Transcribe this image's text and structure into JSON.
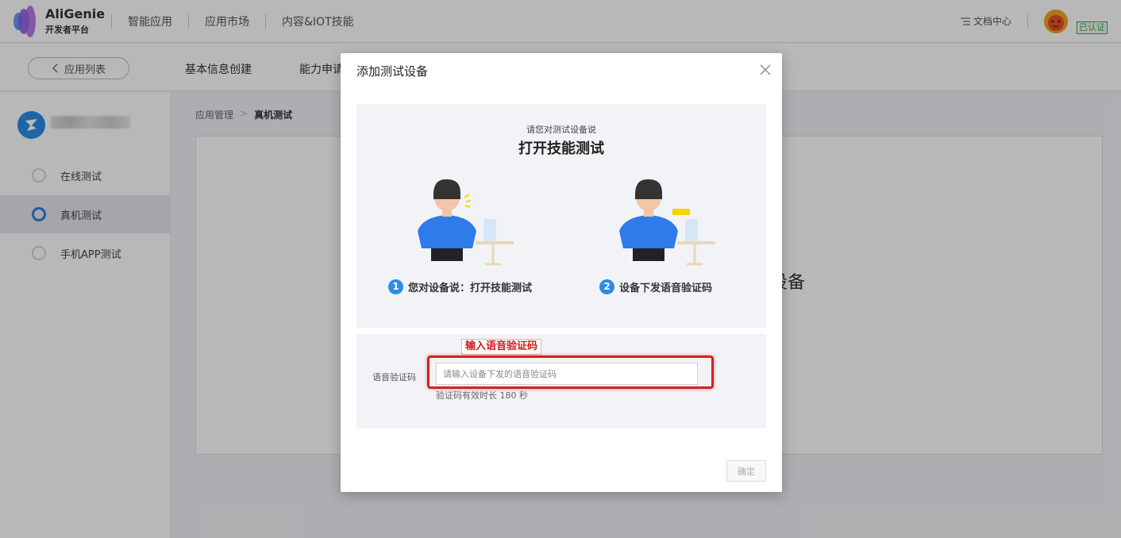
{
  "header": {
    "brand_name": "AliGenie",
    "brand_sub": "开发者平台",
    "nav": [
      "智能应用",
      "应用市场",
      "内容&IOT技能"
    ],
    "doc_link": "文档中心",
    "user_name": "",
    "verified_badge": "已认证"
  },
  "subnav": {
    "back_label": "应用列表",
    "items": [
      "基本信息创建",
      "能力申请"
    ]
  },
  "sidebar": {
    "app_name": "",
    "items": [
      {
        "label": "在线测试",
        "active": false
      },
      {
        "label": "真机测试",
        "active": true
      },
      {
        "label": "手机APP测试",
        "active": false
      }
    ]
  },
  "breadcrumb": {
    "parent": "应用管理",
    "separator": ">",
    "current": "真机测试"
  },
  "panel": {
    "partial_text": "设备"
  },
  "modal": {
    "title": "添加测试设备",
    "instruction_sub": "请您对测试设备说",
    "instruction_main": "打开技能测试",
    "steps": [
      {
        "num": "1",
        "label": "您对设备说：打开技能测试"
      },
      {
        "num": "2",
        "label": "设备下发语音验证码"
      }
    ],
    "annotation": "输入语音验证码",
    "field_label": "语音验证码",
    "input_value": "",
    "input_placeholder": "请输入设备下发的语音验证码",
    "hint": "验证码有效时长 180 秒",
    "confirm_label": "确定"
  },
  "colors": {
    "accent": "#2a8de6",
    "annotation_red": "#d42020",
    "verified_green": "#3aa44a"
  }
}
